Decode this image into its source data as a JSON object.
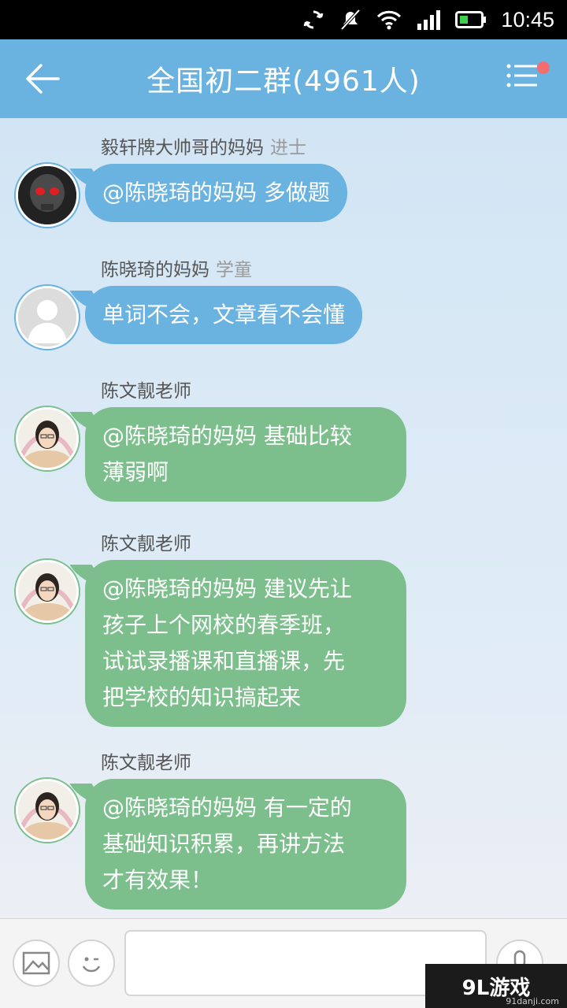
{
  "status_bar": {
    "time": "10:45",
    "icons": [
      "sync-icon",
      "mute-icon",
      "wifi-icon",
      "signal-icon",
      "battery-icon"
    ]
  },
  "header": {
    "title": "全国初二群(4961人)",
    "back_icon": "arrow-left-icon",
    "menu_icon": "list-menu-icon",
    "has_notification_dot": true
  },
  "messages": [
    {
      "sender": "毅轩牌大帅哥的妈妈",
      "rank": "进士",
      "avatar": "skull-avatar",
      "bubble_color": "blue",
      "lines": [
        "@陈晓琦的妈妈 多做题"
      ]
    },
    {
      "sender": "陈晓琦的妈妈",
      "rank": "学童",
      "avatar": "default-avatar",
      "bubble_color": "blue",
      "lines": [
        "单词不会，文章看不会懂"
      ]
    },
    {
      "sender": "陈文靓老师",
      "rank": "",
      "avatar": "teacher-avatar",
      "bubble_color": "green",
      "lines": [
        "@陈晓琦的妈妈 基础比较",
        "薄弱啊"
      ]
    },
    {
      "sender": "陈文靓老师",
      "rank": "",
      "avatar": "teacher-avatar",
      "bubble_color": "green",
      "lines": [
        "@陈晓琦的妈妈 建议先让",
        "孩子上个网校的春季班，",
        "试试录播课和直播课，先",
        "把学校的知识搞起来"
      ]
    },
    {
      "sender": "陈文靓老师",
      "rank": "",
      "avatar": "teacher-avatar",
      "bubble_color": "green",
      "lines": [
        "@陈晓琦的妈妈 有一定的",
        "基础知识积累，再讲方法",
        "才有效果！"
      ]
    }
  ],
  "input_bar": {
    "image_icon": "image-icon",
    "emoji_icon": "emoji-icon",
    "mic_icon": "microphone-icon",
    "input_value": ""
  },
  "watermark": {
    "logo": "9L游戏",
    "domain": "91danji.com"
  },
  "colors": {
    "header_bg": "#6ab2df",
    "bubble_blue": "#6ab2df",
    "bubble_green": "#7cbf8c",
    "notification_dot": "#f36f6f"
  }
}
